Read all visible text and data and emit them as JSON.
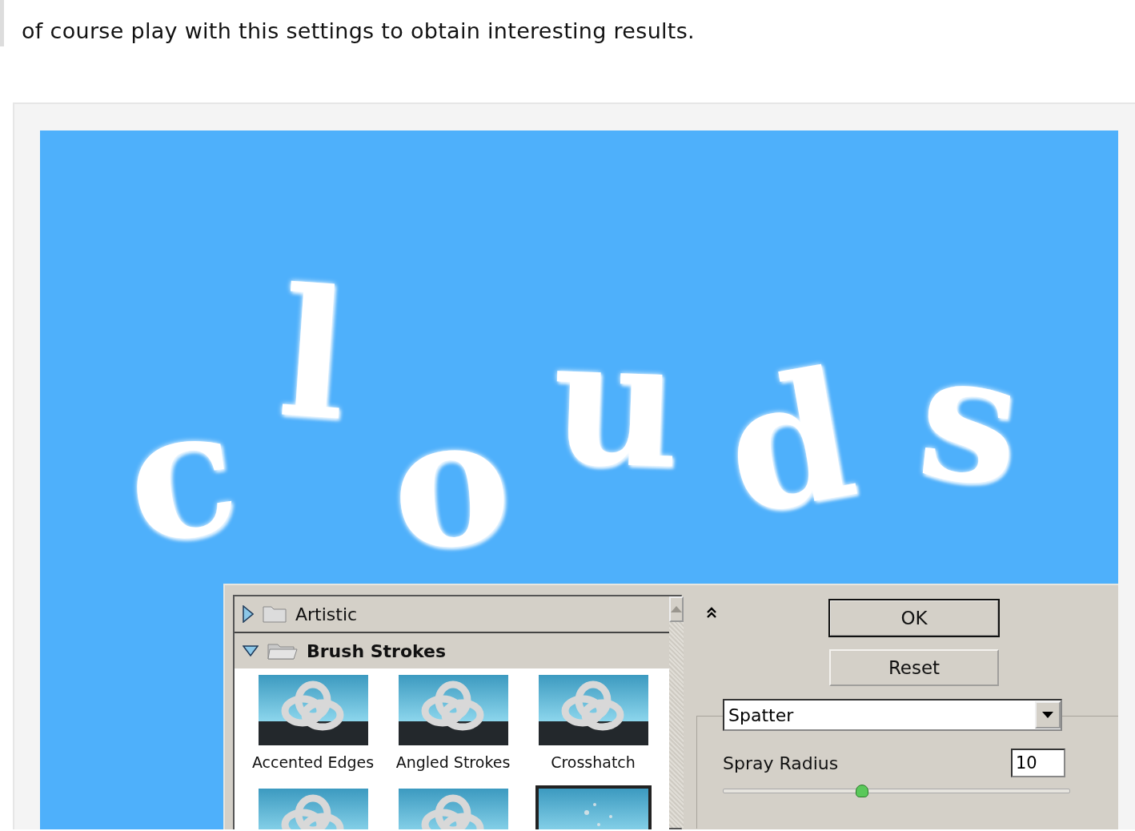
{
  "article": {
    "paragraph": "of course play with this settings to obtain interesting results."
  },
  "canvas": {
    "text": "clouds"
  },
  "filter_gallery": {
    "categories": [
      {
        "name": "Artistic",
        "expanded": false
      },
      {
        "name": "Brush Strokes",
        "expanded": true,
        "filters": [
          {
            "label": "Accented Edges",
            "selected": false
          },
          {
            "label": "Angled Strokes",
            "selected": false
          },
          {
            "label": "Crosshatch",
            "selected": false
          },
          {
            "selected": false
          },
          {
            "selected": false
          },
          {
            "selected": true
          }
        ]
      }
    ]
  },
  "buttons": [
    {
      "label": "OK",
      "default": true
    },
    {
      "label": "Reset",
      "default": false
    }
  ],
  "filter_select": {
    "value": "Spatter"
  },
  "settings": [
    {
      "label": "Spray Radius",
      "value": "10",
      "level": 0.4
    }
  ]
}
